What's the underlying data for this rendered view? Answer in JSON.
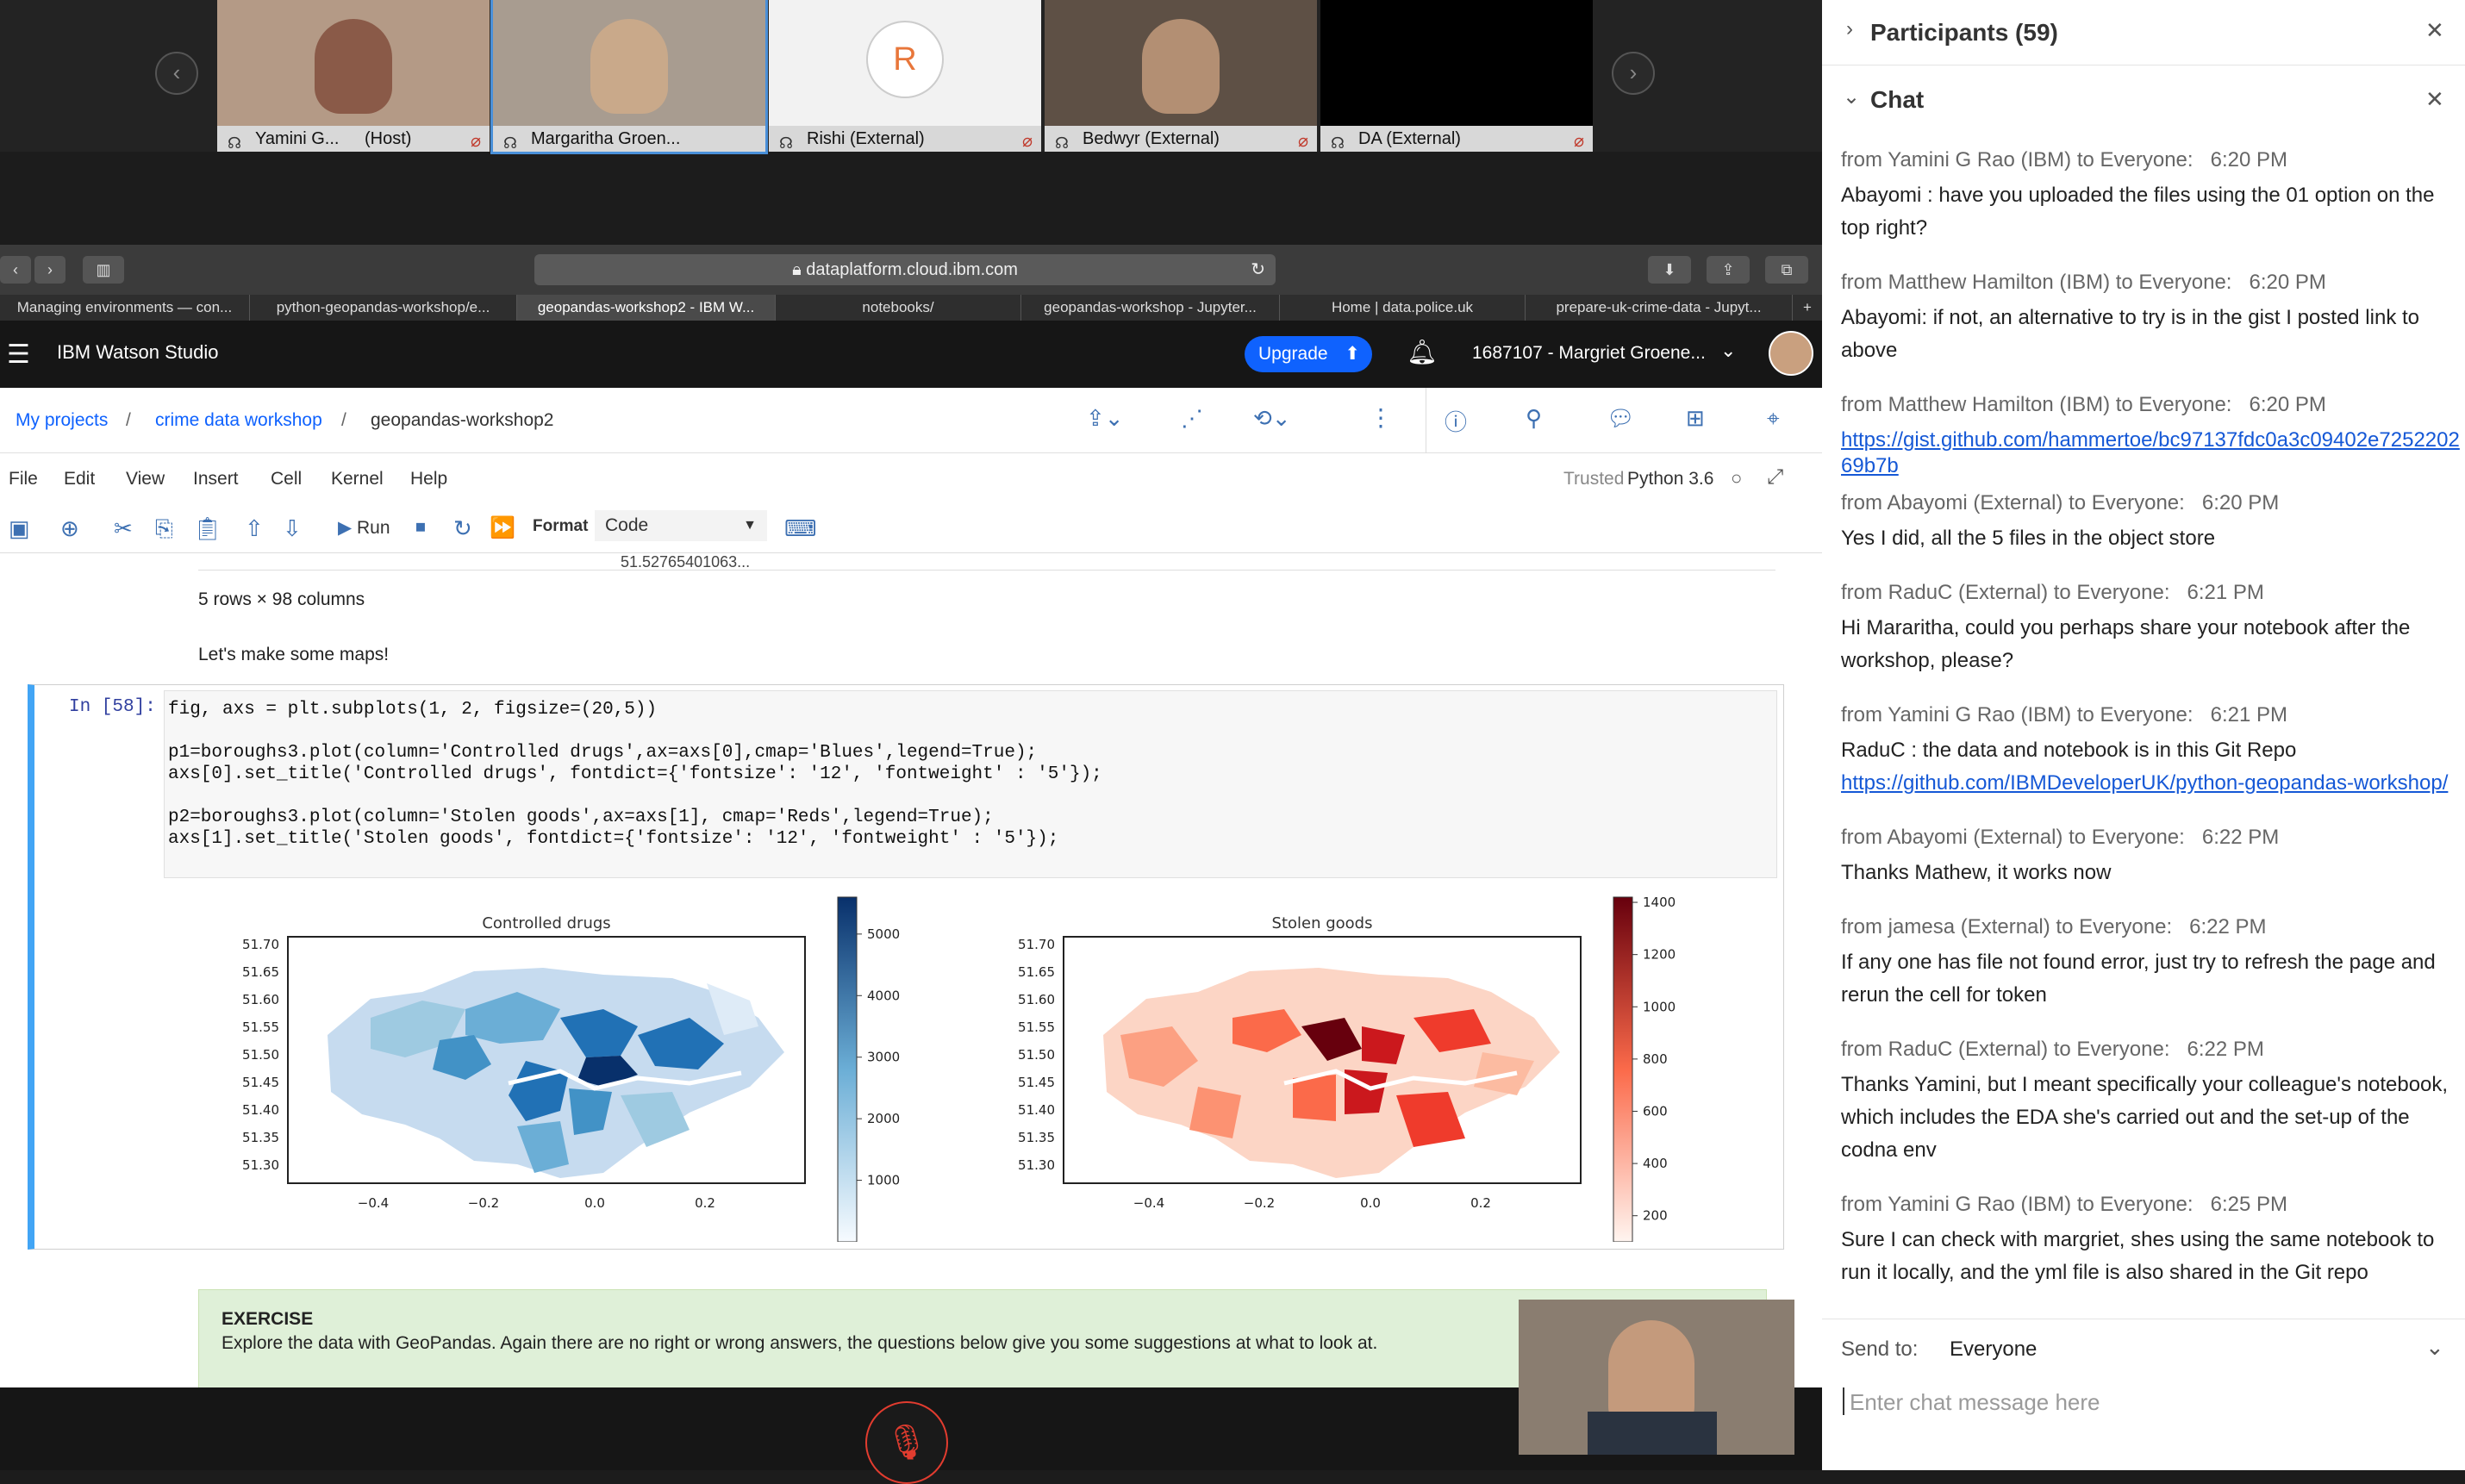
{
  "video": {
    "participants": [
      {
        "name": "Yamini G...",
        "role": "(Host)",
        "initial": ""
      },
      {
        "name": "Margaritha Groen...",
        "role": "",
        "initial": ""
      },
      {
        "name": "Rishi (External)",
        "role": "",
        "initial": "R"
      },
      {
        "name": "Bedwyr (External)",
        "role": "",
        "initial": ""
      },
      {
        "name": "DA (External)",
        "role": "",
        "initial": ""
      }
    ]
  },
  "browser": {
    "url": "dataplatform.cloud.ibm.com",
    "tabs": [
      "Managing environments — con...",
      "python-geopandas-workshop/e...",
      "geopandas-workshop2 - IBM W...",
      "notebooks/",
      "geopandas-workshop - Jupyter...",
      "Home | data.police.uk",
      "prepare-uk-crime-data - Jupyt..."
    ]
  },
  "app": {
    "title": "IBM Watson Studio",
    "upgrade": "Upgrade",
    "account": "1687107 - Margriet Groene...",
    "breadcrumb": [
      "My projects",
      "crime data workshop",
      "geopandas-workshop2"
    ],
    "menu": [
      "File",
      "Edit",
      "View",
      "Insert",
      "Cell",
      "Kernel",
      "Help"
    ],
    "trusted": "Trusted",
    "kernel": "Python 3.6",
    "run": "Run",
    "format_label": "Format",
    "format_value": "Code"
  },
  "notebook": {
    "truncated_value": "51.52765401063...",
    "rows_cols": "5 rows × 98 columns",
    "markdown": "Let's make some maps!",
    "prompt": "In [58]:",
    "code_lines": [
      "fig, axs = plt.subplots(1, 2, figsize=(20,5))",
      "",
      "p1=boroughs3.plot(column='Controlled drugs',ax=axs[0],cmap='Blues',legend=True);",
      "axs[0].set_title('Controlled drugs', fontdict={'fontsize': '12', 'fontweight' : '5'});",
      "",
      "p2=boroughs3.plot(column='Stolen goods',ax=axs[1], cmap='Reds',legend=True);",
      "axs[1].set_title('Stolen goods', fontdict={'fontsize': '12', 'fontweight' : '5'});"
    ],
    "exercise_title": "EXERCISE",
    "exercise_text": "Explore the data with GeoPandas. Again there are no right or wrong answers, the questions below give you some suggestions at what to look at."
  },
  "chart_data": [
    {
      "type": "choropleth",
      "title": "Controlled drugs",
      "cmap": "Blues",
      "xticks": [
        "−0.4",
        "−0.2",
        "0.0",
        "0.2"
      ],
      "yticks": [
        "51.70",
        "51.65",
        "51.60",
        "51.55",
        "51.50",
        "51.45",
        "51.40",
        "51.35",
        "51.30"
      ],
      "colorbar_ticks": [
        "5000",
        "4000",
        "3000",
        "2000",
        "1000"
      ],
      "colorbar_range": [
        0,
        5600
      ]
    },
    {
      "type": "choropleth",
      "title": "Stolen goods",
      "cmap": "Reds",
      "xticks": [
        "−0.4",
        "−0.2",
        "0.0",
        "0.2"
      ],
      "yticks": [
        "51.70",
        "51.65",
        "51.60",
        "51.55",
        "51.50",
        "51.45",
        "51.40",
        "51.35",
        "51.30"
      ],
      "colorbar_ticks": [
        "1400",
        "1200",
        "1000",
        "800",
        "600",
        "400",
        "200"
      ],
      "colorbar_range": [
        100,
        1420
      ]
    }
  ],
  "chat": {
    "participants_header": "Participants (59)",
    "chat_header": "Chat",
    "send_to_label": "Send to:",
    "send_to_value": "Everyone",
    "input_placeholder": "Enter chat message here",
    "messages": [
      {
        "from": "from Yamini G Rao (IBM) to Everyone:",
        "time": "6:20  PM",
        "text": "Abayomi : have you uploaded the files using the 01 option on the top right?"
      },
      {
        "from": "from Matthew Hamilton (IBM) to Everyone:",
        "time": "6:20  PM",
        "text": "Abayomi: if not, an alternative to try is in the gist I posted link to above"
      },
      {
        "from": "from Matthew Hamilton (IBM) to Everyone:",
        "time": "6:20  PM",
        "link": "https://gist.github.com/hammertoe/bc97137fdc0a3c09402e725220269b7b"
      },
      {
        "from": "from Abayomi (External) to Everyone:",
        "time": "6:20  PM",
        "text": "Yes I did, all the 5 files in the object store"
      },
      {
        "from": "from RaduC (External) to Everyone:",
        "time": "6:21  PM",
        "text": "Hi Mararitha, could you perhaps share your notebook after the workshop, please?"
      },
      {
        "from": "from Yamini G Rao (IBM) to Everyone:",
        "time": "6:21  PM",
        "text": "RaduC : the data and notebook is in this Git Repo ",
        "link": "https://github.com/IBMDeveloperUK/python-geopandas-workshop/"
      },
      {
        "from": "from Abayomi (External) to Everyone:",
        "time": "6:22  PM",
        "text": "Thanks Mathew, it works now"
      },
      {
        "from": "from jamesa (External) to Everyone:",
        "time": "6:22  PM",
        "text": "If any one has file not found error, just try to refresh the page and rerun the cell for token"
      },
      {
        "from": "from RaduC (External) to Everyone:",
        "time": "6:22  PM",
        "text": "Thanks Yamini, but I meant specifically your colleague's notebook, which includes the EDA she's carried out and the set-up of the codna env"
      },
      {
        "from": "from Yamini G Rao (IBM) to Everyone:",
        "time": "6:25  PM",
        "text": "Sure I can check with margriet, shes using the same notebook to run it locally, and the yml file is also shared in the Git repo"
      }
    ]
  }
}
